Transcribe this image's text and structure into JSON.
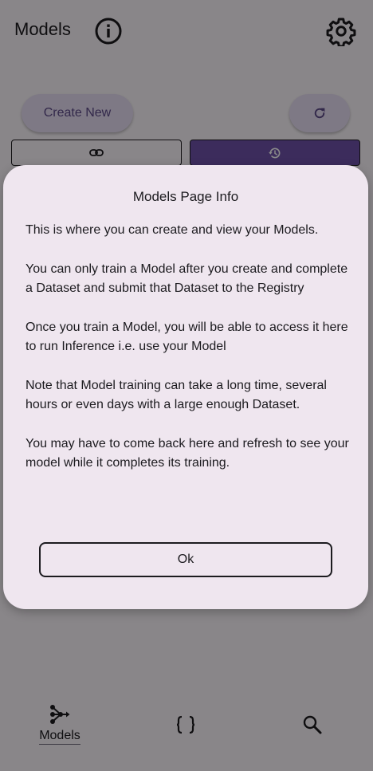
{
  "app_bar": {
    "title": "Models",
    "info_icon": "info-circle-icon",
    "settings_icon": "gear-icon"
  },
  "toolbar": {
    "create_label": "Create New",
    "refresh_icon": "refresh-icon",
    "segment_left_icon": "link-icon",
    "segment_right_icon": "history-icon"
  },
  "bottom_nav": {
    "items": [
      {
        "label": "Models",
        "icon": "model-graph-icon",
        "selected": true
      },
      {
        "label": "",
        "icon": "braces-icon",
        "selected": false
      },
      {
        "label": "",
        "icon": "magnify-icon",
        "selected": false
      }
    ]
  },
  "dialog": {
    "title": "Models Page Info",
    "paragraphs": [
      "This is where you can create and view your Models.",
      "You can only train a Model after you create and complete a Dataset and submit that Dataset to the Registry",
      "Once you train a Model, you will be able to access it here to run Inference i.e. use your Model",
      "Note that Model training can take a long time, several hours or even days with a large enough Dataset.",
      "You may have to come back here and refresh to see your model while it completes its training."
    ],
    "ok_label": "Ok"
  },
  "colors": {
    "accent": "#6f52ab",
    "dialog_bg": "#efe6ef",
    "button_tonal": "#e9dff6"
  }
}
